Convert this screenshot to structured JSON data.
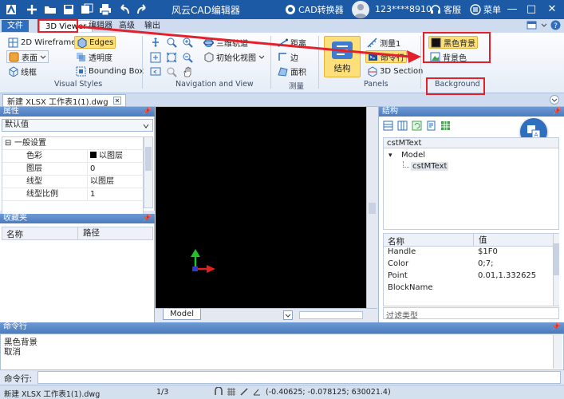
{
  "titlebar": {
    "title": "风云CAD编辑器",
    "cad_convert": "CAD转换器",
    "user_name": "123****8910",
    "support": "客服",
    "menu": "菜单"
  },
  "ribbon_tabs": [
    "文件",
    "3D Viewer",
    "编辑器",
    "高级",
    "输出"
  ],
  "ribbon": {
    "visual_styles": {
      "label": "Visual Styles",
      "wireframe_2d": "2D Wireframe",
      "edges": "Edges",
      "surface": "表面",
      "transparency": "透明度",
      "wireframe": "线框",
      "bounding_box": "Bounding Box"
    },
    "navigation": {
      "label": "Navigation and View",
      "orbit_3d": "三维轨道",
      "init_view": "初始化视图"
    },
    "measure": {
      "label": "测量",
      "distance": "距离",
      "edge": "边",
      "area": "面积"
    },
    "panels": {
      "label": "Panels",
      "structure": "结构",
      "measure1": "测量1",
      "command_line": "命令行",
      "section_3d": "3D Section"
    },
    "background": {
      "label": "Background",
      "black_bg": "黑色背景",
      "bg_color": "背景色"
    }
  },
  "document_tab": "新建 XLSX 工作表1(1).dwg",
  "properties": {
    "title": "属性",
    "selector": "默认值",
    "group": "一般设置",
    "rows": [
      {
        "name": "色彩",
        "value": "以图层"
      },
      {
        "name": "图层",
        "value": "0"
      },
      {
        "name": "线型",
        "value": "以图层"
      },
      {
        "name": "线型比例",
        "value": "1"
      }
    ]
  },
  "favorites": {
    "title": "收藏夹",
    "col_name": "名称",
    "col_path": "路径"
  },
  "viewport": {
    "model_tab": "Model"
  },
  "structure": {
    "title": "结构",
    "selected": "cstMText",
    "tree_root": "Model",
    "tree_child": "cstMText",
    "prop_col_name": "名称",
    "prop_col_value": "值",
    "props": [
      {
        "name": "Handle",
        "value": "$1F0"
      },
      {
        "name": "Color",
        "value": "0;7;"
      },
      {
        "name": "Point",
        "value": "0.01,1.332625"
      },
      {
        "name": "BlockName",
        "value": ""
      }
    ],
    "filter_placeholder": "过滤类型"
  },
  "command": {
    "title": "命令行",
    "history": [
      "黑色背景",
      "取消"
    ],
    "input_label": "命令行:"
  },
  "status": {
    "file": "新建 XLSX 工作表1(1).dwg",
    "page": "1/3",
    "coords": "(-0.40625; -0.078125; 630021.4)"
  },
  "colors": {
    "title_bar": "#1c5aa6",
    "panel_header": "#4a7bbd",
    "highlight": "#fde07a",
    "annotation_red": "#e3212b"
  }
}
